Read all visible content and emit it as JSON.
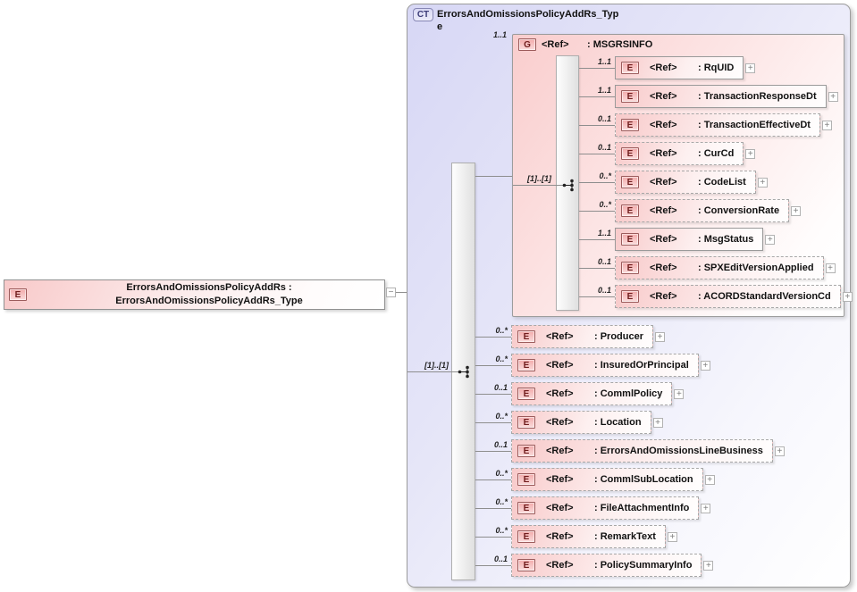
{
  "glyphs": {
    "expand": "+",
    "collapse": "−"
  },
  "colors": {
    "container_lavender": "#d7d7f5",
    "element_pink": "#f8caca",
    "badge_border": "#9c5c5c",
    "badge_text": "#701d1d",
    "ct_badge_text": "#3c3c78",
    "line_gray": "#8e8e8e"
  },
  "root_element": {
    "badge": "E",
    "label": "ErrorsAndOmissionsPolicyAddRs : ErrorsAndOmissionsPolicyAddRs_Type"
  },
  "complex_type": {
    "badge": "CT",
    "title": "ErrorsAndOmissionsPolicyAddRs_Type",
    "sequence_cardinality": "[1]..[1]",
    "msgrsinfo_group": {
      "badge": "G",
      "ref": "<Ref>",
      "name": ": MSGRSINFO",
      "cardinality": "1..1",
      "sequence_cardinality": "[1]..[1]",
      "children": [
        {
          "badge": "E",
          "ref": "<Ref>",
          "name": ": RqUID",
          "cardinality": "1..1",
          "required": true
        },
        {
          "badge": "E",
          "ref": "<Ref>",
          "name": ": TransactionResponseDt",
          "cardinality": "1..1",
          "required": true
        },
        {
          "badge": "E",
          "ref": "<Ref>",
          "name": ": TransactionEffectiveDt",
          "cardinality": "0..1",
          "required": false
        },
        {
          "badge": "E",
          "ref": "<Ref>",
          "name": ": CurCd",
          "cardinality": "0..1",
          "required": false
        },
        {
          "badge": "E",
          "ref": "<Ref>",
          "name": ": CodeList",
          "cardinality": "0..*",
          "required": false
        },
        {
          "badge": "E",
          "ref": "<Ref>",
          "name": ": ConversionRate",
          "cardinality": "0..*",
          "required": false
        },
        {
          "badge": "E",
          "ref": "<Ref>",
          "name": ": MsgStatus",
          "cardinality": "1..1",
          "required": true
        },
        {
          "badge": "E",
          "ref": "<Ref>",
          "name": ": SPXEditVersionApplied",
          "cardinality": "0..1",
          "required": false
        },
        {
          "badge": "E",
          "ref": "<Ref>",
          "name": ": ACORDStandardVersionCd",
          "cardinality": "0..1",
          "required": false
        }
      ]
    },
    "children": [
      {
        "badge": "E",
        "ref": "<Ref>",
        "name": ": Producer",
        "cardinality": "0..*",
        "required": false
      },
      {
        "badge": "E",
        "ref": "<Ref>",
        "name": ": InsuredOrPrincipal",
        "cardinality": "0..*",
        "required": false
      },
      {
        "badge": "E",
        "ref": "<Ref>",
        "name": ": CommlPolicy",
        "cardinality": "0..1",
        "required": false
      },
      {
        "badge": "E",
        "ref": "<Ref>",
        "name": ": Location",
        "cardinality": "0..*",
        "required": false
      },
      {
        "badge": "E",
        "ref": "<Ref>",
        "name": ": ErrorsAndOmissionsLineBusiness",
        "cardinality": "0..1",
        "required": false
      },
      {
        "badge": "E",
        "ref": "<Ref>",
        "name": ": CommlSubLocation",
        "cardinality": "0..*",
        "required": false
      },
      {
        "badge": "E",
        "ref": "<Ref>",
        "name": ": FileAttachmentInfo",
        "cardinality": "0..*",
        "required": false
      },
      {
        "badge": "E",
        "ref": "<Ref>",
        "name": ": RemarkText",
        "cardinality": "0..*",
        "required": false
      },
      {
        "badge": "E",
        "ref": "<Ref>",
        "name": ": PolicySummaryInfo",
        "cardinality": "0..1",
        "required": false
      }
    ]
  }
}
